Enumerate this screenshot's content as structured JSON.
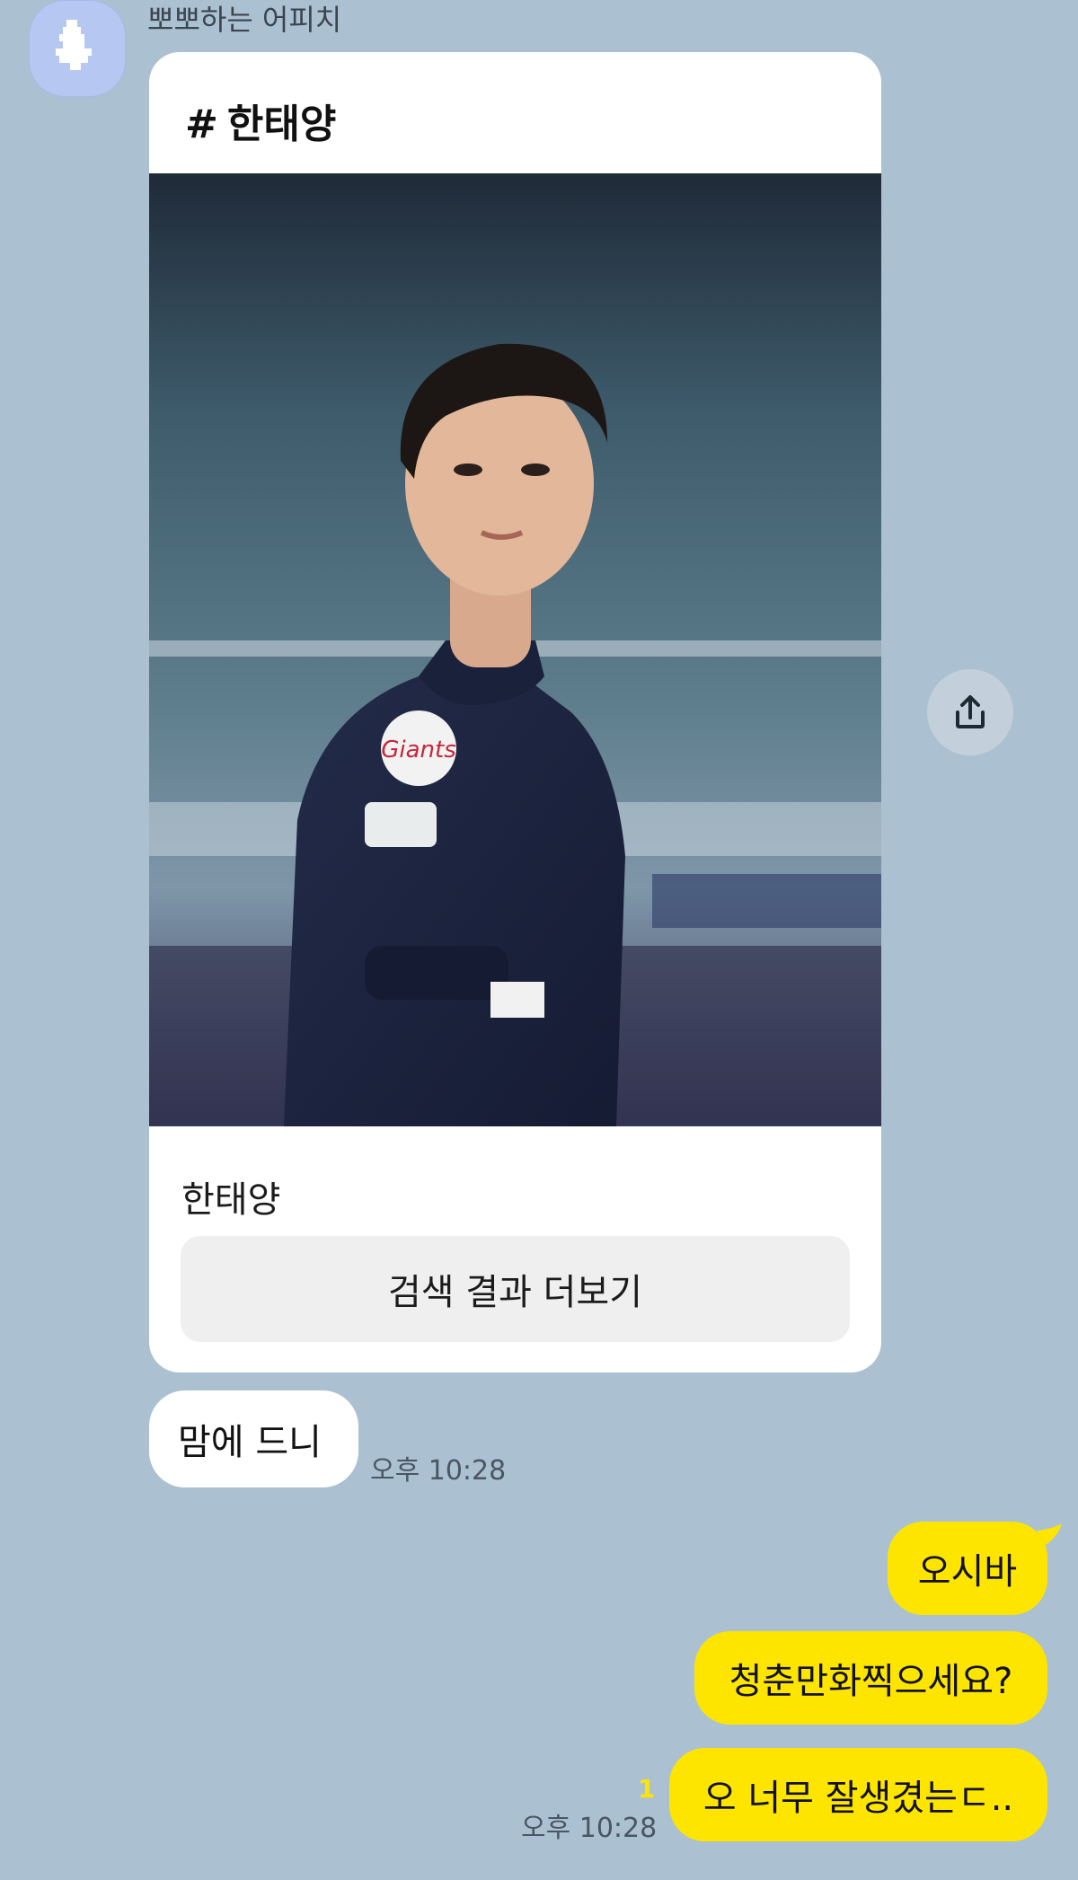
{
  "sender": {
    "name": "뽀뽀하는 어피치"
  },
  "card": {
    "hash": "#",
    "title": "한태양",
    "caption": "한태양",
    "more_button_label": "검색 결과 더보기",
    "photo_icon": "person-photo-icon"
  },
  "incoming": {
    "text": "맘에 드니",
    "time": "오후 10:28"
  },
  "outgoing": {
    "messages": [
      "오시바",
      "청춘만화찍으세요?",
      "오 너무 잘생겼는ㄷ.."
    ],
    "unread_count": "1",
    "time": "오후 10:28"
  },
  "icons": {
    "share": "share-icon",
    "avatar": "avatar-icon"
  },
  "colors": {
    "background": "#abc1d1",
    "outgoing_bubble": "#fee500",
    "incoming_bubble": "#ffffff",
    "unread": "#fee500"
  }
}
